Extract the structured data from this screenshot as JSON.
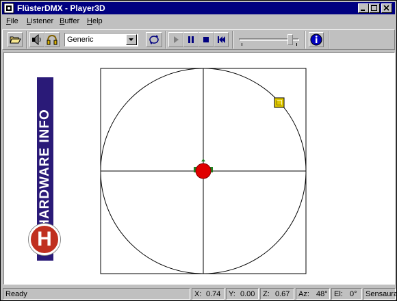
{
  "window": {
    "title": "FlüsterDMX - Player3D"
  },
  "menu": [
    {
      "label": "File",
      "key": "F",
      "rest": "ile"
    },
    {
      "label": "Listener",
      "key": "L",
      "rest": "istener"
    },
    {
      "label": "Buffer",
      "key": "B",
      "rest": "uffer"
    },
    {
      "label": "Help",
      "key": "H",
      "rest": "elp"
    }
  ],
  "toolbar": {
    "preset_value": "Generic",
    "volume_level": 0.85
  },
  "watermark": {
    "text": "HARDWARE INFO",
    "letter": "H"
  },
  "status": {
    "message": "Ready",
    "x_label": "X:",
    "x_value": "0.74",
    "y_label": "Y:",
    "y_value": "0.00",
    "z_label": "Z:",
    "z_value": "0.67",
    "az_label": "Az:",
    "az_value": "48°",
    "el_label": "El:",
    "el_value": "0°",
    "device": "Sensaura"
  },
  "colors": {
    "title_bar": "#000080",
    "listener": "#e00000",
    "source": "#e0c800",
    "logo_bar": "#2a1a78",
    "logo_badge": "#c03020"
  }
}
